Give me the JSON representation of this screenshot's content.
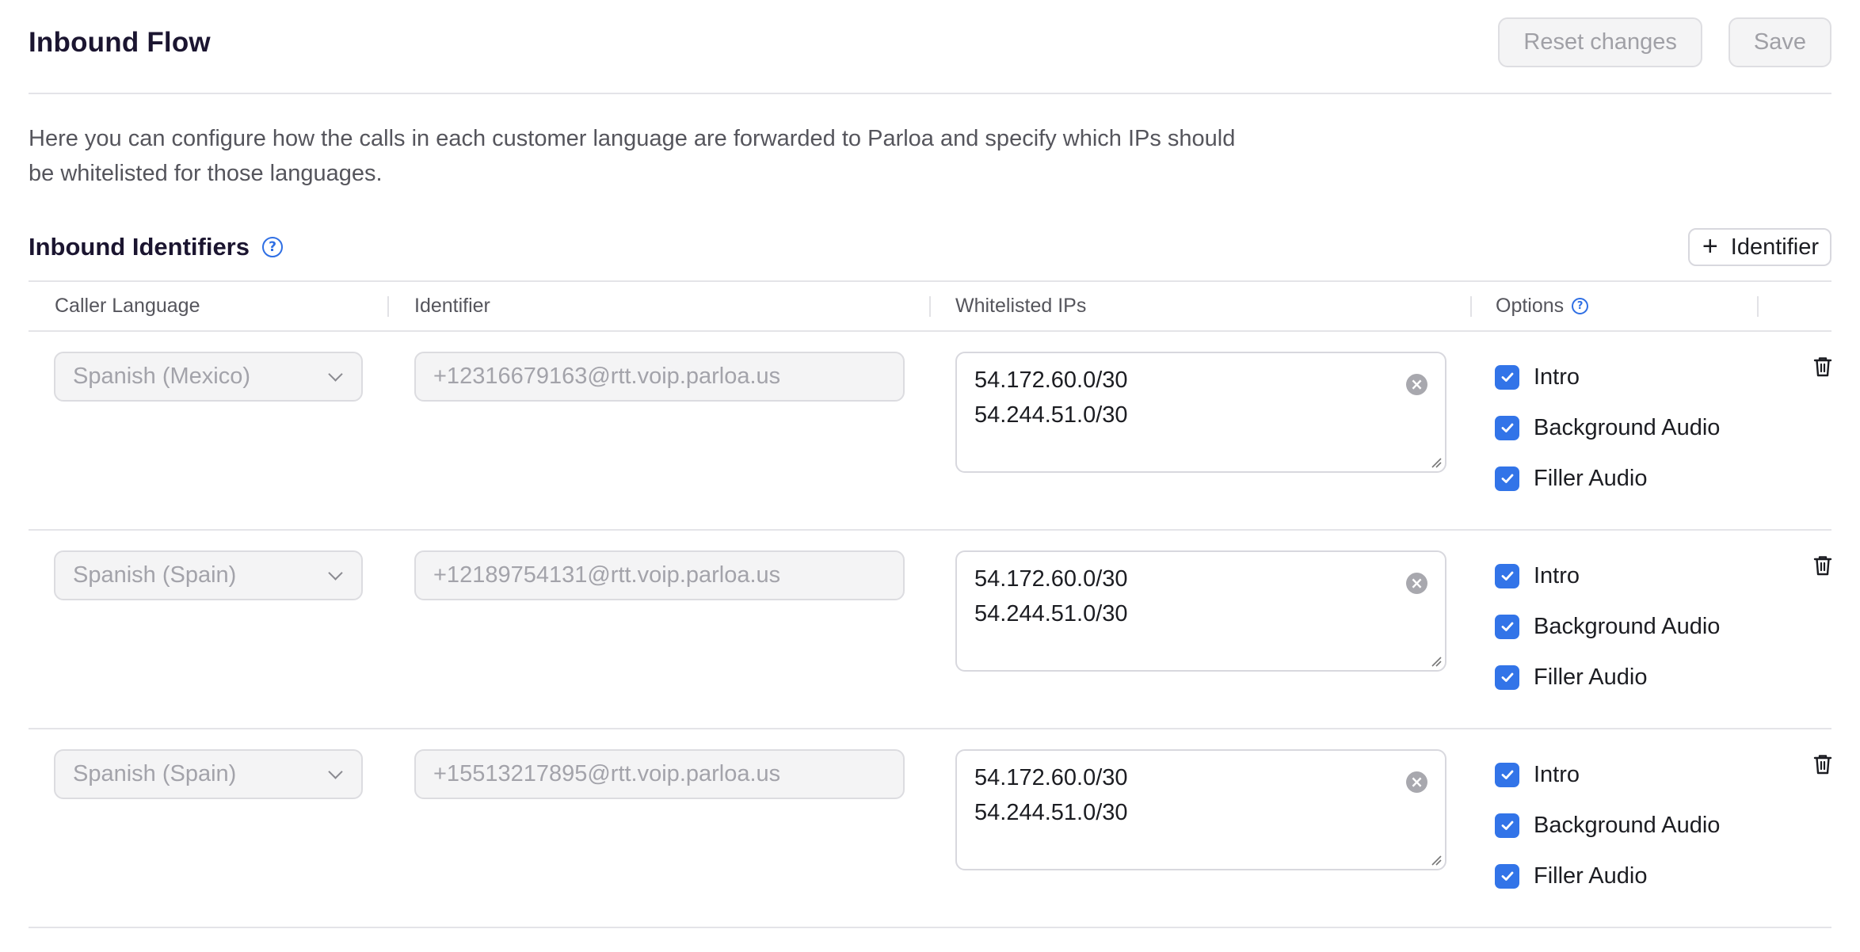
{
  "header": {
    "title": "Inbound Flow",
    "reset_label": "Reset changes",
    "save_label": "Save"
  },
  "description": "Here you can configure how the calls in each customer language are forwarded to Parloa and specify which IPs should be whitelisted for those languages.",
  "section": {
    "title": "Inbound Identifiers",
    "add_label": "Identifier"
  },
  "columns": {
    "language": "Caller Language",
    "identifier": "Identifier",
    "ips": "Whitelisted IPs",
    "options": "Options"
  },
  "rows": [
    {
      "language": "Spanish (Mexico)",
      "identifier": "+12316679163@rtt.voip.parloa.us",
      "ips": [
        "54.172.60.0/30",
        "54.244.51.0/30"
      ],
      "options": [
        {
          "label": "Intro",
          "checked": true
        },
        {
          "label": "Background Audio",
          "checked": true
        },
        {
          "label": "Filler Audio",
          "checked": true
        }
      ]
    },
    {
      "language": "Spanish (Spain)",
      "identifier": "+12189754131@rtt.voip.parloa.us",
      "ips": [
        "54.172.60.0/30",
        "54.244.51.0/30"
      ],
      "options": [
        {
          "label": "Intro",
          "checked": true
        },
        {
          "label": "Background Audio",
          "checked": true
        },
        {
          "label": "Filler Audio",
          "checked": true
        }
      ]
    },
    {
      "language": "Spanish (Spain)",
      "identifier": "+15513217895@rtt.voip.parloa.us",
      "ips": [
        "54.172.60.0/30",
        "54.244.51.0/30"
      ],
      "options": [
        {
          "label": "Intro",
          "checked": true
        },
        {
          "label": "Background Audio",
          "checked": true
        },
        {
          "label": "Filler Audio",
          "checked": true
        }
      ]
    }
  ],
  "colors": {
    "accent": "#3274e8",
    "title": "#1b1530",
    "muted_text": "#55555c",
    "disabled_text": "#a3a3aa"
  },
  "icons": {
    "help": "question-circle-icon",
    "add": "plus-icon",
    "select": "chevron-down-icon",
    "clear": "clear-icon",
    "check": "check-icon",
    "delete": "trash-icon"
  }
}
